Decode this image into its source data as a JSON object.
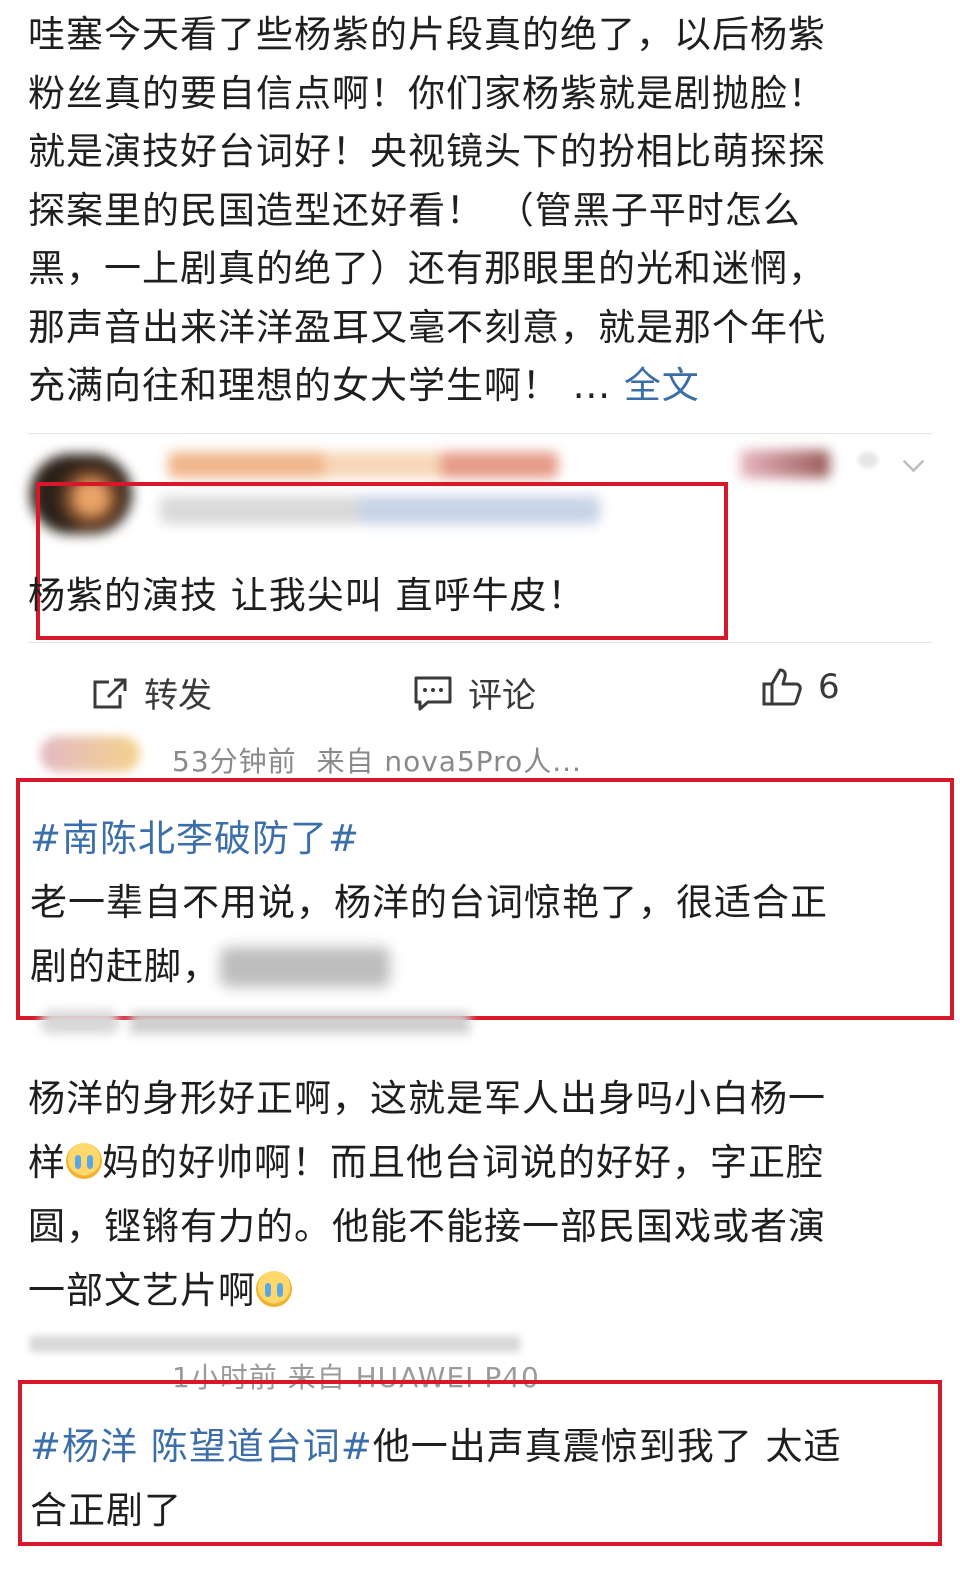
{
  "post": {
    "lines": [
      "哇塞今天看了些杨紫的片段真的绝了，以后杨紫",
      "粉丝真的要自信点啊！你们家杨紫就是剧抛脸！",
      "就是演技好台词好！央视镜头下的扮相比萌探探",
      "探案里的民国造型还好看！ （管黑子平时怎么",
      "黑，一上剧真的绝了）还有那眼里的光和迷惘，",
      "那声音出来洋洋盈耳又毫不刻意，就是那个年代",
      "充满向往和理想的女大学生啊！ ..."
    ],
    "expand_label": "全文"
  },
  "comment1": {
    "text": "杨紫的演技 让我尖叫 直呼牛皮！"
  },
  "actions": {
    "repost_label": "转发",
    "comment_label": "评论",
    "like_count": "6"
  },
  "comment2": {
    "meta_time": "53分钟前",
    "meta_source": "来自 nova5Pro人...",
    "hashtag": "#南陈北李破防了#",
    "line1": "老一辈自不用说，杨洋的台词惊艳了，很适合正",
    "line2": "剧的赶脚，"
  },
  "comment3": {
    "line1": "杨洋的身形好正啊，这就是军人出身吗小白杨一",
    "line2a": "样",
    "line2b": "妈的好帅啊！而且他台词说的好好，字正腔",
    "line3": "圆，铿锵有力的。他能不能接一部民国戏或者演",
    "line4": "一部文艺片啊",
    "emoji_name": "crying-face-icon"
  },
  "comment4": {
    "meta": "1小时前 来自 HUAWEI P40",
    "hashtag": "#杨洋 陈望道台词#",
    "text_a": "他一出声真震惊到我了 太适",
    "text_b": "合正剧了"
  },
  "colors": {
    "highlight_box": "#d7182a",
    "link": "#3a6ea8"
  }
}
